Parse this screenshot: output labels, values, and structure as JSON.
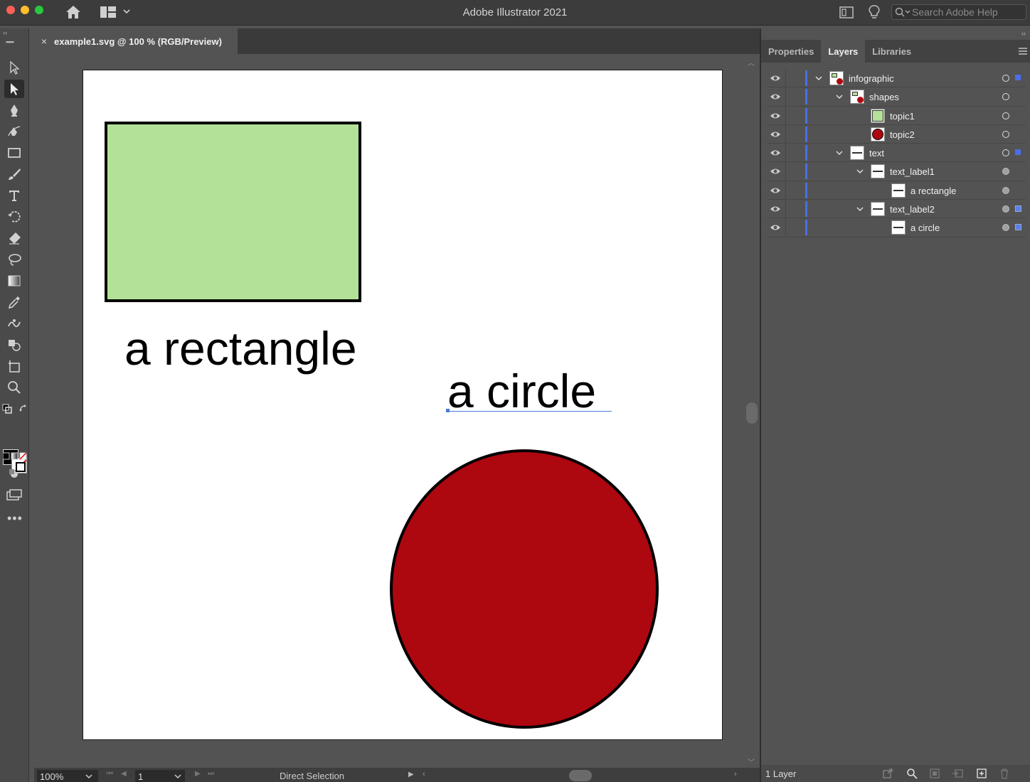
{
  "titlebar": {
    "app_title": "Adobe Illustrator 2021",
    "search_placeholder": "Search Adobe Help"
  },
  "document": {
    "tab_title": "example1.svg @ 100 % (RGB/Preview)",
    "close_glyph": "×"
  },
  "artboard": {
    "label_rectangle": "a rectangle",
    "label_circle": "a circle",
    "colors": {
      "rectangle_fill": "#b3e197",
      "circle_fill": "#ad0710",
      "stroke": "#000000",
      "selection": "#4a7bdc"
    }
  },
  "tools": [
    {
      "name": "selection-tool",
      "icon": "arrow-icon"
    },
    {
      "name": "direct-selection-tool",
      "icon": "direct-arrow-icon",
      "active": true
    },
    {
      "name": "pen-tool",
      "icon": "pen-icon"
    },
    {
      "name": "curvature-tool",
      "icon": "curvature-icon"
    },
    {
      "name": "rectangle-tool",
      "icon": "rectangle-icon"
    },
    {
      "name": "paintbrush-tool",
      "icon": "brush-icon"
    },
    {
      "name": "type-tool",
      "icon": "type-icon"
    },
    {
      "name": "rotate-tool",
      "icon": "rotate-icon"
    },
    {
      "name": "eraser-tool",
      "icon": "eraser-icon"
    },
    {
      "name": "lasso-tool",
      "icon": "lasso-icon"
    },
    {
      "name": "gradient-tool",
      "icon": "gradient-icon"
    },
    {
      "name": "eyedropper-tool",
      "icon": "eyedropper-icon"
    },
    {
      "name": "puppet-warp-tool",
      "icon": "puppet-icon"
    },
    {
      "name": "shape-builder-tool",
      "icon": "shape-builder-icon"
    },
    {
      "name": "artboard-tool",
      "icon": "artboard-icon"
    },
    {
      "name": "zoom-tool",
      "icon": "zoom-icon"
    }
  ],
  "panel": {
    "tabs": [
      "Properties",
      "Layers",
      "Libraries"
    ],
    "active_tab": "Layers",
    "layers": [
      {
        "name": "infographic",
        "depth": 0,
        "twirl": true,
        "thumb": "group",
        "target": "hollow",
        "selected": "small"
      },
      {
        "name": "shapes",
        "depth": 1,
        "twirl": true,
        "thumb": "group",
        "target": "hollow",
        "selected": ""
      },
      {
        "name": "topic1",
        "depth": 2,
        "twirl": false,
        "thumb": "rect",
        "target": "hollow",
        "selected": ""
      },
      {
        "name": "topic2",
        "depth": 2,
        "twirl": false,
        "thumb": "circle",
        "target": "hollow",
        "selected": ""
      },
      {
        "name": "text",
        "depth": 1,
        "twirl": true,
        "thumb": "text",
        "target": "hollow",
        "selected": "small"
      },
      {
        "name": "text_label1",
        "depth": 2,
        "twirl": true,
        "thumb": "text",
        "target": "filled",
        "selected": ""
      },
      {
        "name": "a rectangle",
        "depth": 3,
        "twirl": false,
        "thumb": "text",
        "target": "filled",
        "selected": ""
      },
      {
        "name": "text_label2",
        "depth": 2,
        "twirl": true,
        "thumb": "text",
        "target": "filled",
        "selected": "big"
      },
      {
        "name": "a circle",
        "depth": 3,
        "twirl": false,
        "thumb": "text",
        "target": "filled",
        "selected": "big"
      }
    ],
    "layer_count": "1 Layer"
  },
  "statusbar": {
    "zoom": "100%",
    "page": "1",
    "current_tool": "Direct Selection"
  }
}
